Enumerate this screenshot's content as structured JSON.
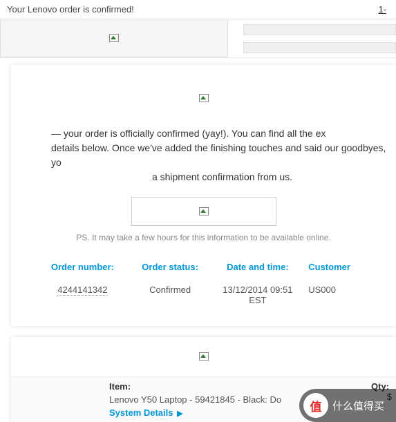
{
  "header": {
    "title": "Your Lenovo order is confirmed!",
    "right_fragment": "1-"
  },
  "body": {
    "line1": " — your order is officially confirmed (yay!). You can find all the ex",
    "line2": "details below. Once we've added the finishing touches and said our goodbyes, yo",
    "line3": "a shipment confirmation from us.",
    "ps": "PS. It may take a few hours for this information to be available online."
  },
  "info": {
    "order_number_label": "Order number:",
    "order_number_value": "4244141342",
    "order_status_label": "Order status:",
    "order_status_value": "Confirmed",
    "date_time_label": "Date and time:",
    "date_time_value": "13/12/2014 09:51 EST",
    "customer_label": "Customer",
    "customer_value": "US000"
  },
  "item": {
    "item_label": "Item:",
    "qty_label": "Qty:",
    "name": "Lenovo Y50 Laptop - 59421845 - Black: Do",
    "price_fragment": "$",
    "system_details": "System Details",
    "arrow": "▶"
  },
  "watermark": {
    "badge": "值",
    "text": "什么值得买"
  }
}
